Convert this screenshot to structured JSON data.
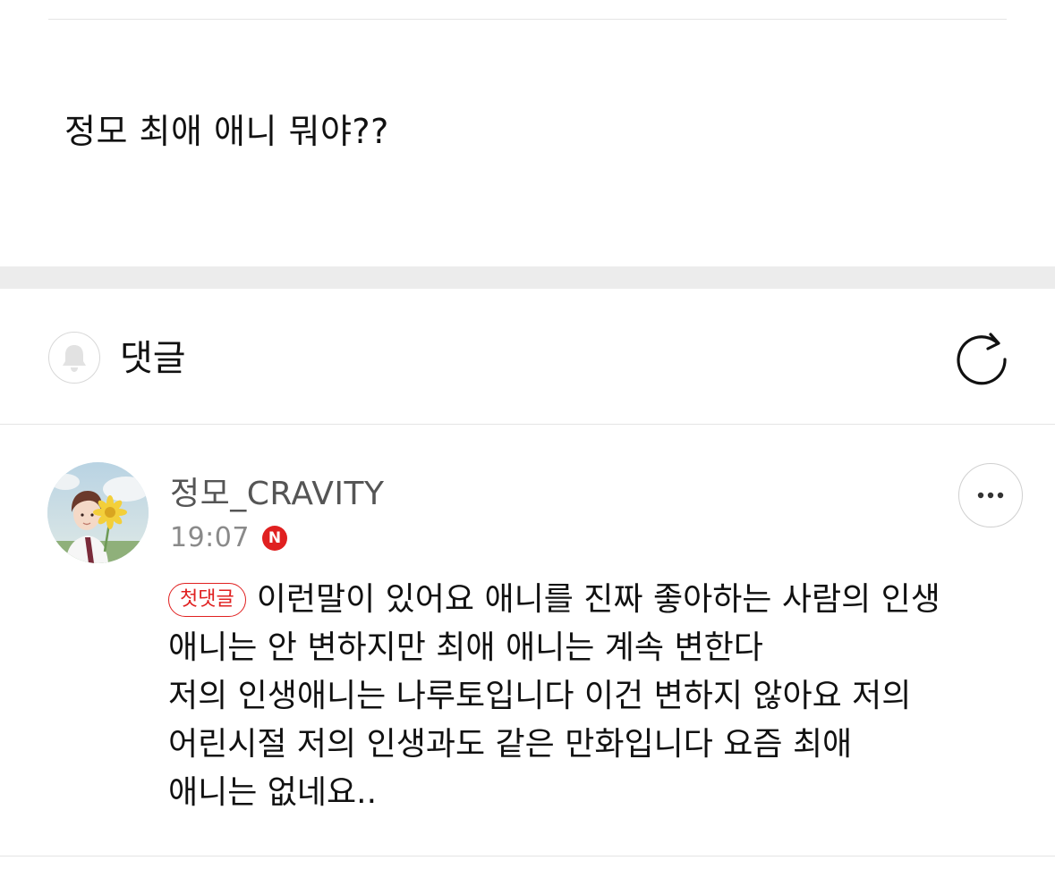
{
  "post": {
    "question": "정모 최애 애니 뭐야??"
  },
  "comments_section": {
    "title": "댓글",
    "bell_icon": "bell-icon",
    "refresh_icon": "refresh-icon"
  },
  "comment": {
    "author": "정모_CRAVITY",
    "time": "19:07",
    "new_badge": "N",
    "first_comment_badge": "첫댓글",
    "lines": [
      "이런말이 있어요 애니를 진짜 좋아하는 사람의 인생",
      "애니는 안 변하지만 최애 애니는 계속 변한다",
      "저의 인생애니는 나루토입니다 이건 변하지 않아요 저의",
      "어린시절 저의 인생과도 같은 만화입니다 요즘 최애",
      "애니는 없네요.."
    ],
    "more_icon": "more-options-icon"
  },
  "colors": {
    "accent_red": "#e02020",
    "divider": "#e4e4e4",
    "section_gap": "#ececec",
    "text_primary": "#111111",
    "text_secondary": "#555555",
    "text_muted": "#8a8a8a"
  }
}
